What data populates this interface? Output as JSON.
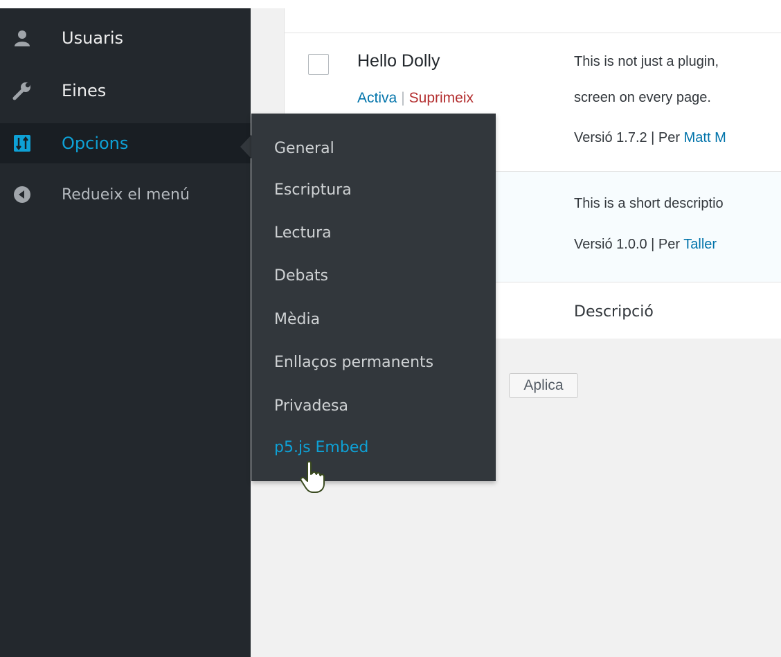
{
  "sidebar": {
    "items": [
      {
        "label": "Usuaris",
        "icon": "user-icon"
      },
      {
        "label": "Eines",
        "icon": "wrench-icon"
      },
      {
        "label": "Opcions",
        "icon": "settings-sliders-icon"
      },
      {
        "label": "Redueix el menú",
        "icon": "collapse-arrow-icon"
      }
    ]
  },
  "flyout": {
    "items": [
      {
        "label": "General"
      },
      {
        "label": "Escriptura"
      },
      {
        "label": "Lectura"
      },
      {
        "label": "Debats"
      },
      {
        "label": "Mèdia"
      },
      {
        "label": "Enllaços permanents"
      },
      {
        "label": "Privadesa"
      },
      {
        "label": "p5.js Embed"
      }
    ]
  },
  "plugins": {
    "row1": {
      "name": "Hello Dolly",
      "action_activate": "Activa",
      "action_separator": "|",
      "action_delete": "Suprimeix",
      "desc_line1": "This is not just a plugin,",
      "desc_line2": "screen on every page.",
      "meta_prefix": "Versió 1.7.2 | Per ",
      "meta_author": "Matt M"
    },
    "row2": {
      "desc_line1": "This is a short descriptio",
      "meta_prefix": "Versió 1.0.0 | Per ",
      "meta_author": "Taller"
    },
    "footer_column": "Descripció"
  },
  "bulk": {
    "apply_label": "Aplica"
  },
  "colors": {
    "sidebar_bg": "#23282d",
    "flyout_bg": "#32373c",
    "accent": "#0ea1d6",
    "link": "#0073aa",
    "delete": "#b32d2e"
  }
}
